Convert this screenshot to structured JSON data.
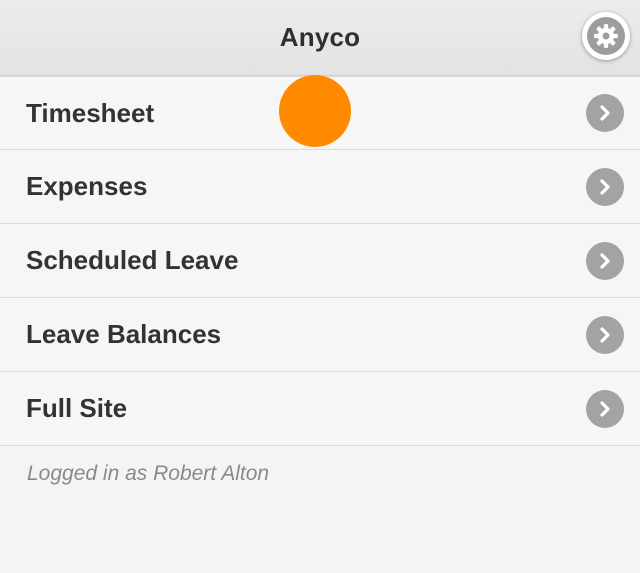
{
  "header": {
    "title": "Anyco",
    "settings_icon": "gear-icon"
  },
  "menu": {
    "items": [
      {
        "label": "Timesheet",
        "icon": "chevron-right-icon"
      },
      {
        "label": "Expenses",
        "icon": "chevron-right-icon"
      },
      {
        "label": "Scheduled Leave",
        "icon": "chevron-right-icon"
      },
      {
        "label": "Leave Balances",
        "icon": "chevron-right-icon"
      },
      {
        "label": "Full Site",
        "icon": "chevron-right-icon"
      }
    ]
  },
  "footer": {
    "status": "Logged in as Robert Alton"
  },
  "colors": {
    "header_bg": "#e6e6e6",
    "list_bg": "#f6f6f6",
    "text": "#333333",
    "icon_bg": "#a3a3a3",
    "touch_indicator": "#ff8a00"
  }
}
